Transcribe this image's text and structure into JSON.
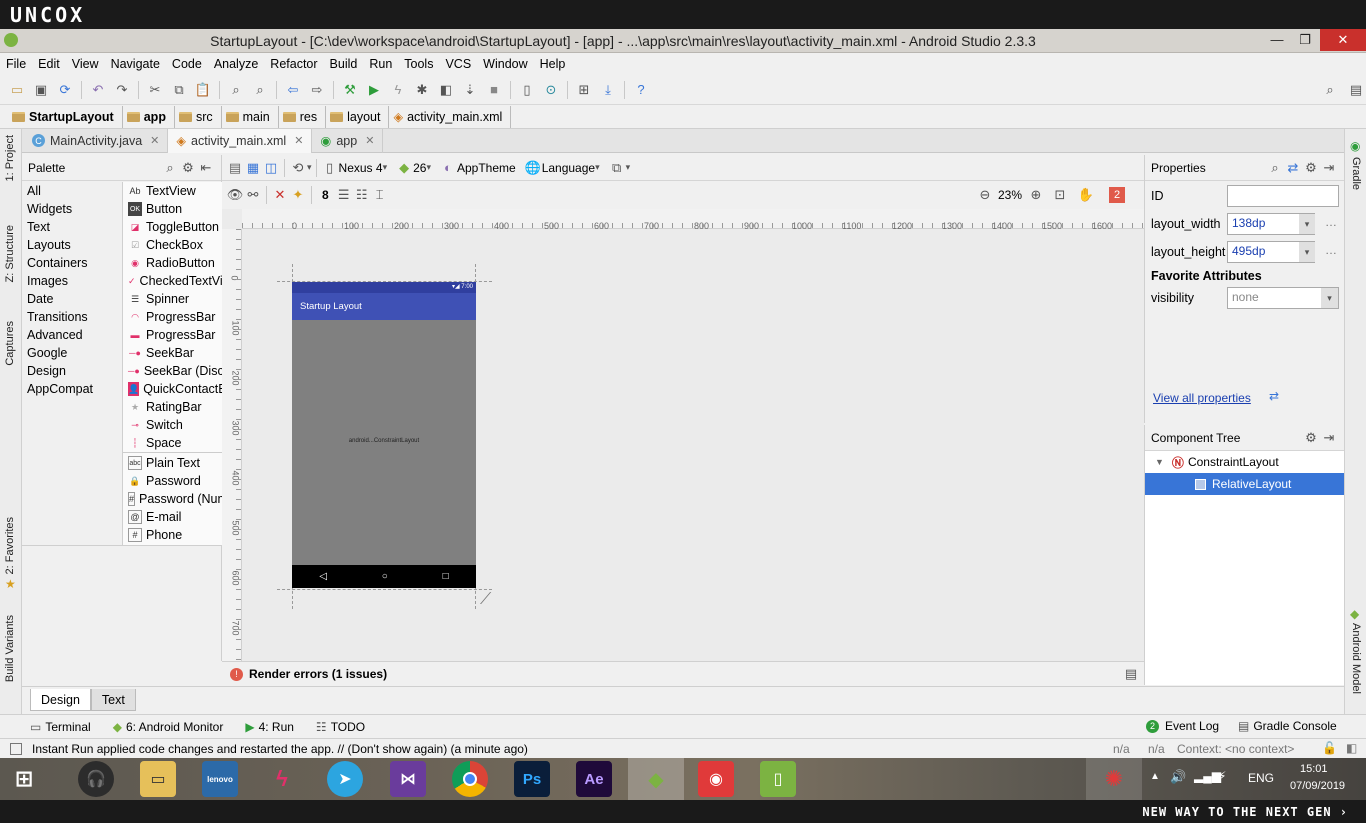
{
  "watermark_top": "UNCOX",
  "watermark_bottom": "NEW WAY TO THE NEXT GEN ›",
  "window": {
    "title": "StartupLayout - [C:\\dev\\workspace\\android\\StartupLayout] - [app] - ...\\app\\src\\main\\res\\layout\\activity_main.xml - Android Studio 2.3.3",
    "minimize": "—",
    "maximize": "❐",
    "close": "✕"
  },
  "menu": [
    "File",
    "Edit",
    "View",
    "Navigate",
    "Code",
    "Analyze",
    "Refactor",
    "Build",
    "Run",
    "Tools",
    "VCS",
    "Window",
    "Help"
  ],
  "breadcrumb": [
    "StartupLayout",
    "app",
    "src",
    "main",
    "res",
    "layout",
    "activity_main.xml"
  ],
  "editor_tabs": [
    {
      "label": "MainActivity.java",
      "icon": "C"
    },
    {
      "label": "activity_main.xml",
      "icon": "◈"
    },
    {
      "label": "app",
      "icon": "◉"
    }
  ],
  "left_strip": {
    "project": "1: Project",
    "structure": "Z: Structure",
    "captures": "Captures",
    "favorites": "2: Favorites",
    "build_variants": "Build Variants"
  },
  "right_strip": {
    "gradle": "Gradle",
    "android_model": "Android Model"
  },
  "palette": {
    "title": "Palette",
    "categories": [
      "All",
      "Widgets",
      "Text",
      "Layouts",
      "Containers",
      "Images",
      "Date",
      "Transitions",
      "Advanced",
      "Google",
      "Design",
      "AppCompat"
    ],
    "items_widgets": [
      {
        "icon": "Ab",
        "label": "TextView"
      },
      {
        "icon": "OK",
        "label": "Button"
      },
      {
        "icon": "◪",
        "label": "ToggleButton"
      },
      {
        "icon": "☑",
        "label": "CheckBox"
      },
      {
        "icon": "◉",
        "label": "RadioButton"
      },
      {
        "icon": "✓",
        "label": "CheckedTextView"
      },
      {
        "icon": "☰",
        "label": "Spinner"
      },
      {
        "icon": "◠",
        "label": "ProgressBar"
      },
      {
        "icon": "▬",
        "label": "ProgressBar"
      },
      {
        "icon": "─●",
        "label": "SeekBar"
      },
      {
        "icon": "─●",
        "label": "SeekBar (Discrete)"
      },
      {
        "icon": "👤",
        "label": "QuickContactBadge"
      },
      {
        "icon": "★",
        "label": "RatingBar"
      },
      {
        "icon": "⊸",
        "label": "Switch"
      },
      {
        "icon": "┆",
        "label": "Space"
      }
    ],
    "items_text": [
      {
        "icon": "abc",
        "label": "Plain Text"
      },
      {
        "icon": "🔒",
        "label": "Password"
      },
      {
        "icon": "#",
        "label": "Password (Numeric)"
      },
      {
        "icon": "@",
        "label": "E-mail"
      },
      {
        "icon": "#",
        "label": "Phone"
      }
    ]
  },
  "canvas_toolbar": {
    "device": "Nexus 4",
    "api": "26",
    "theme": "AppTheme",
    "language": "Language",
    "margin": "8",
    "zoom": "23%",
    "error_count": "2"
  },
  "rulers": {
    "h": [
      "0",
      "100",
      "200",
      "300",
      "400",
      "500",
      "600",
      "700",
      "800",
      "900",
      "1000",
      "1100",
      "1200",
      "1300",
      "1400",
      "1500",
      "1600"
    ],
    "v": [
      "0",
      "100",
      "200",
      "300",
      "400",
      "500",
      "600",
      "700"
    ]
  },
  "phone": {
    "status_time": "▾◢ 7:00",
    "app_title": "Startup Layout",
    "center_text": "android...ConstraintLayout",
    "nav": [
      "◁",
      "○",
      "□"
    ]
  },
  "render_errors": "Render errors (1 issues)",
  "properties": {
    "title": "Properties",
    "id_label": "ID",
    "id_value": "",
    "width_label": "layout_width",
    "width_value": "138dp",
    "height_label": "layout_height",
    "height_value": "495dp",
    "favorites_header": "Favorite Attributes",
    "visibility_label": "visibility",
    "visibility_value": "none",
    "view_all": "View all properties"
  },
  "component_tree": {
    "title": "Component Tree",
    "root": "ConstraintLayout",
    "child": "RelativeLayout"
  },
  "bottom_tabs": [
    "Design",
    "Text"
  ],
  "tool_windows": {
    "terminal": "Terminal",
    "monitor": "6: Android Monitor",
    "run": "4: Run",
    "todo": "TODO",
    "event_log": "Event Log",
    "event_count": "2",
    "gradle_console": "Gradle Console"
  },
  "status": {
    "message": "Instant Run applied code changes and restarted the app. // (Don't show again) (a minute ago)",
    "na1": "n/a",
    "na2": "n/a",
    "context": "Context: <no context>"
  },
  "taskbar": {
    "lang": "ENG",
    "time": "15:01",
    "date": "07/09/2019",
    "ps": "Ps",
    "ae": "Ae",
    "lenovo": "lenovo"
  },
  "colors": {
    "accent": "#3875d7",
    "appbar": "#3f51b5",
    "statusbar": "#303f9f",
    "error": "#e05a4a"
  }
}
